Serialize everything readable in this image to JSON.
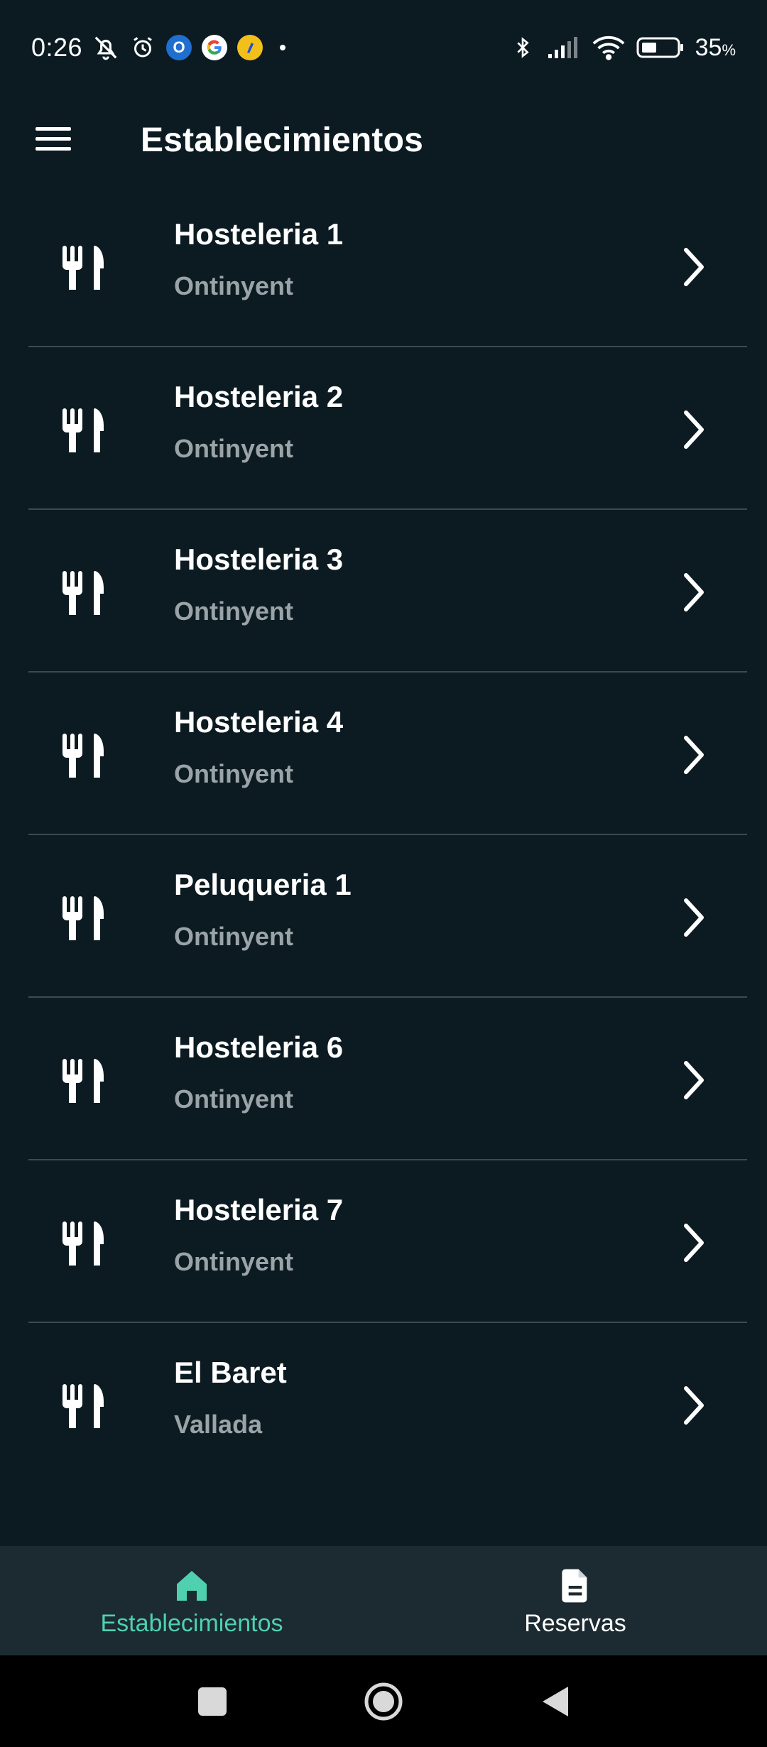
{
  "status_bar": {
    "time": "0:26",
    "battery": "35",
    "battery_unit": "%"
  },
  "app_bar": {
    "title": "Establecimientos"
  },
  "establishments": [
    {
      "name": "Hosteleria 1",
      "city": "Ontinyent"
    },
    {
      "name": "Hosteleria 2",
      "city": "Ontinyent"
    },
    {
      "name": "Hosteleria 3",
      "city": "Ontinyent"
    },
    {
      "name": "Hosteleria 4",
      "city": "Ontinyent"
    },
    {
      "name": "Peluqueria 1",
      "city": "Ontinyent"
    },
    {
      "name": "Hosteleria 6",
      "city": "Ontinyent"
    },
    {
      "name": "Hosteleria 7",
      "city": "Ontinyent"
    },
    {
      "name": "El Baret",
      "city": "Vallada"
    }
  ],
  "bottom_nav": {
    "items": [
      {
        "label": "Establecimientos",
        "icon": "home-icon",
        "active": true
      },
      {
        "label": "Reservas",
        "icon": "document-icon",
        "active": false
      }
    ]
  },
  "colors": {
    "background": "#0c1b22",
    "accent": "#4fd1b0",
    "subtitle": "#9aa3a7",
    "divider": "#3c4b52",
    "nav_bg": "#1c2a31"
  }
}
